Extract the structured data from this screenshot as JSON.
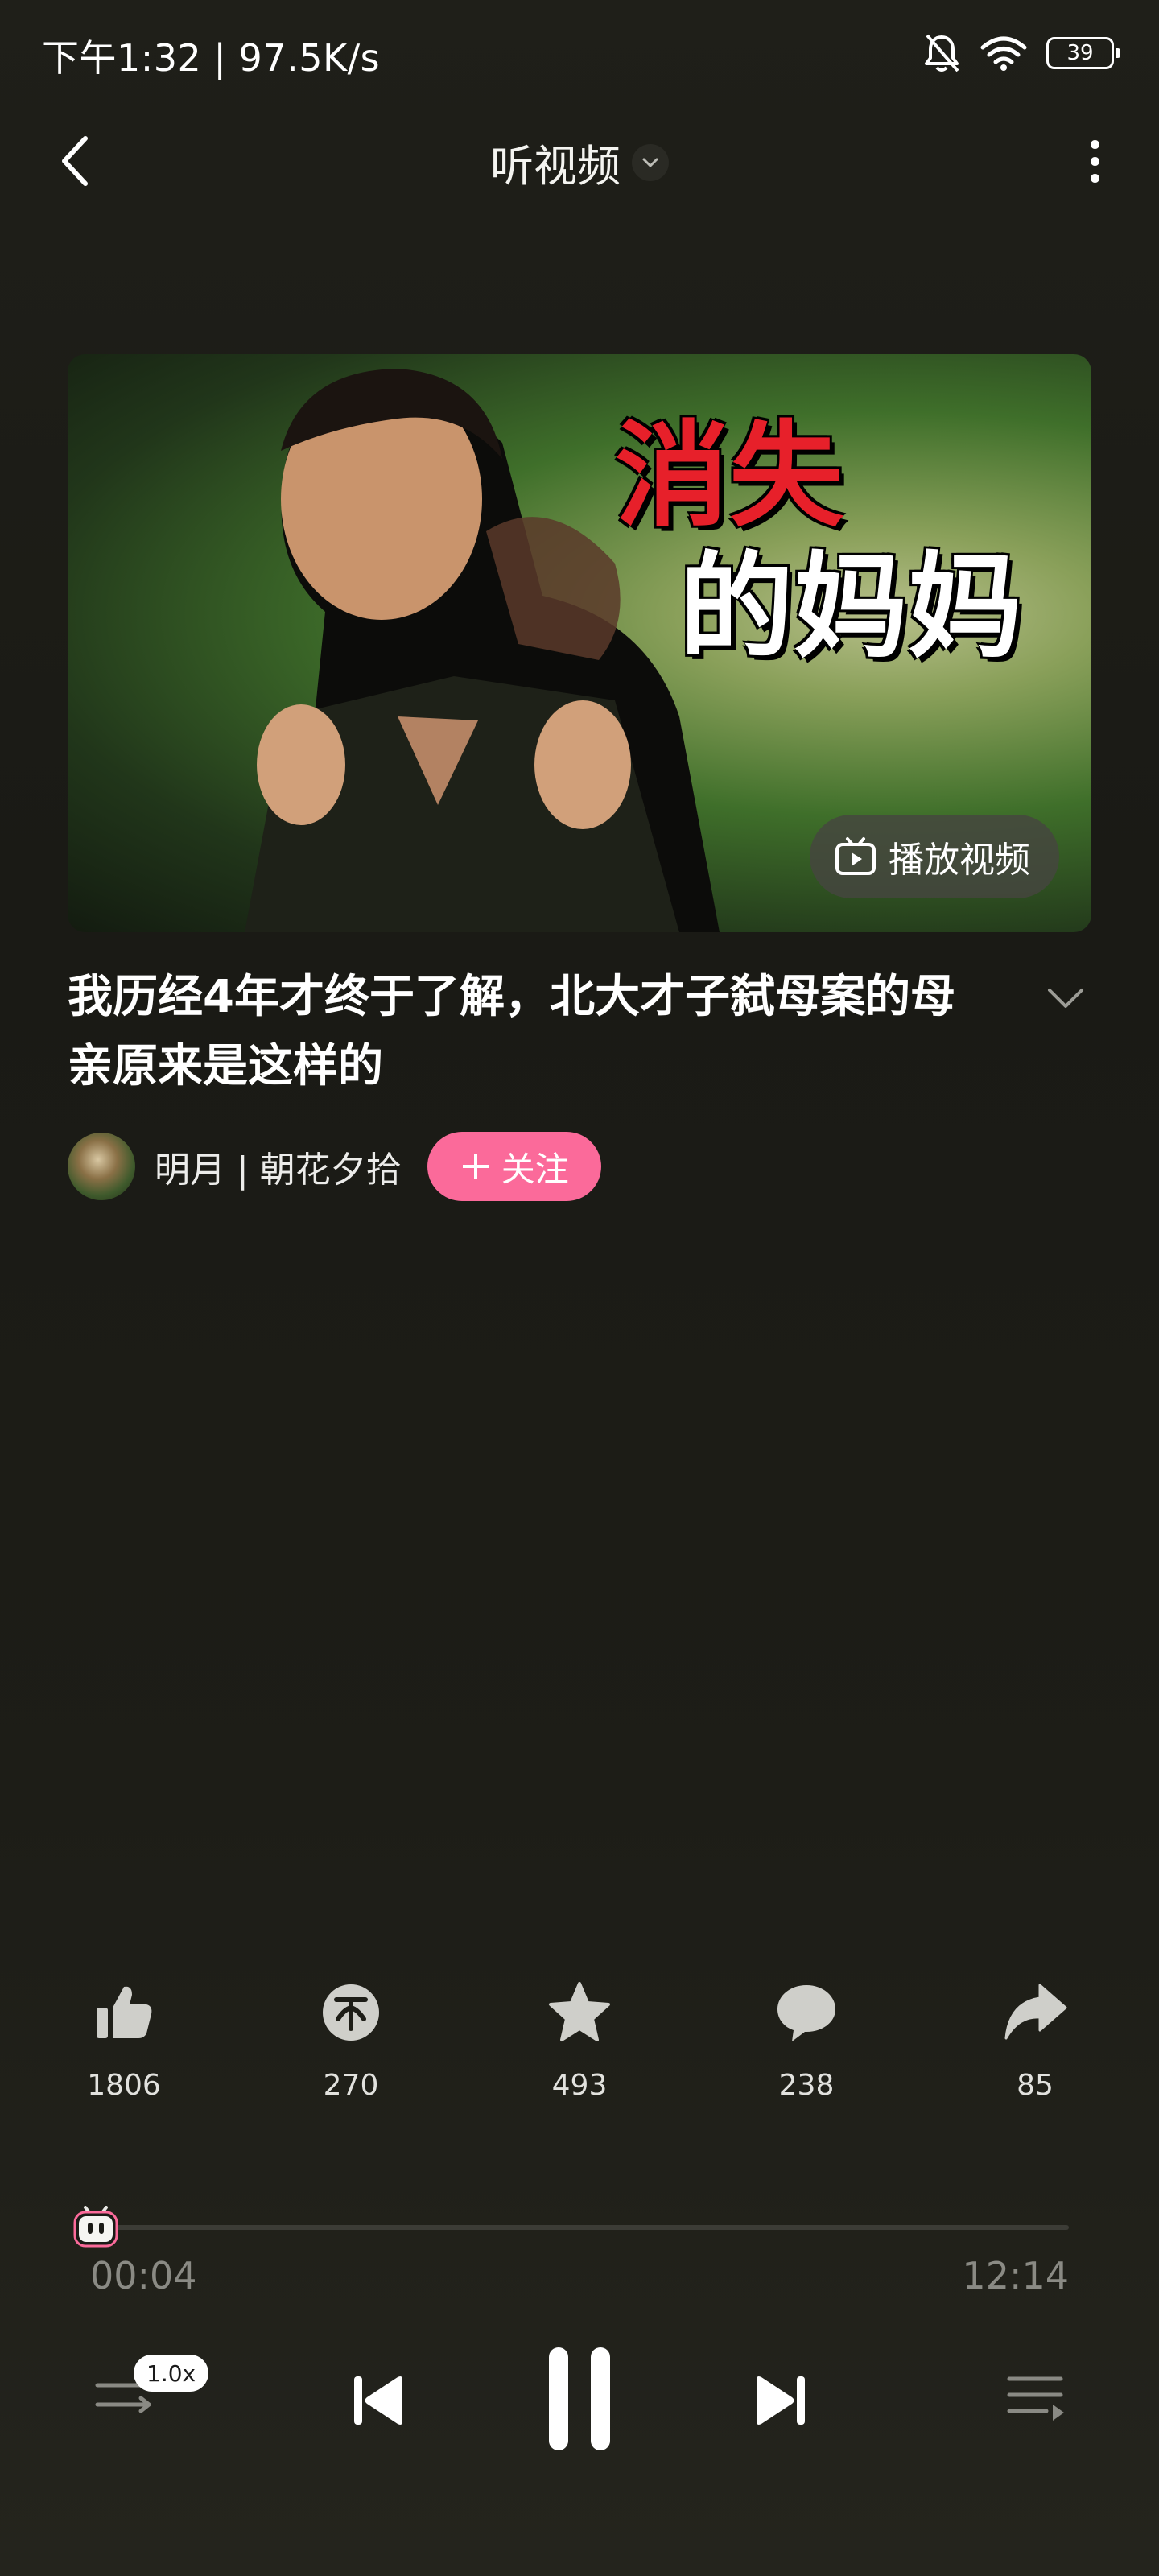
{
  "status_bar": {
    "time_speed": "下午1:32 | 97.5K/s",
    "battery": "39",
    "icons": [
      "bell-mute-icon",
      "wifi-icon",
      "battery-icon"
    ]
  },
  "header": {
    "title": "听视频",
    "icons": [
      "back-arrow-icon",
      "chevron-down-icon",
      "more-vertical-icon"
    ]
  },
  "cover": {
    "title_line1": "消失",
    "title_line2": "的妈妈",
    "play_video_label": "播放视频"
  },
  "video": {
    "title": "我历经4年才终于了解，北大才子弑母案的母亲原来是这样的"
  },
  "author": {
    "name": "明月 | 朝花夕拾",
    "follow_label": "关注"
  },
  "actions": {
    "like": {
      "icon": "thumbs-up-icon",
      "count": "1806"
    },
    "coin": {
      "icon": "coin-icon",
      "count": "270"
    },
    "favorite": {
      "icon": "star-icon",
      "count": "493"
    },
    "comment": {
      "icon": "comment-icon",
      "count": "238"
    },
    "share": {
      "icon": "share-icon",
      "count": "85"
    }
  },
  "player": {
    "current_time": "00:04",
    "total_time": "12:14",
    "progress": 0.005,
    "speed": "1.0x",
    "icons": [
      "speed-icon",
      "previous-icon",
      "pause-icon",
      "next-icon",
      "playlist-icon"
    ]
  },
  "colors": {
    "accent_pink": "#fb6a9a",
    "cover_title_red": "#e7202a"
  }
}
